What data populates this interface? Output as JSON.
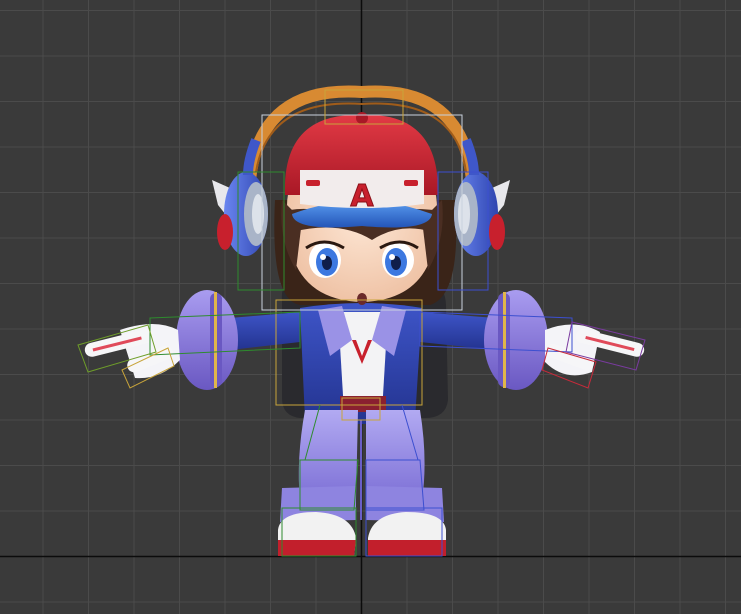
{
  "viewport": {
    "background": "#3a3a3a",
    "grid_color": "#4b4b4b",
    "axis_color": "#0c0c0c"
  },
  "scene": {
    "character": "chibi-boy-rig",
    "colors": {
      "cap_red": "#c8202d",
      "visor_blue": "#2f6fd0",
      "headphone_band": "#d88a32",
      "headphone_blue": "#3f57c9",
      "jacket_blue": "#2d3fa8",
      "sleeve_lavender": "#8a78d8",
      "pants_lavender": "#9a92e6",
      "shirt_white": "#f3f3f5",
      "skin": "#f6d7c0",
      "hair_brown": "#4a2e22",
      "eye_blue": "#3c78e0",
      "shoe_white": "#f2f2f2",
      "shoe_red": "#c21f2c"
    },
    "cap_letter": "A",
    "shirt_letter": "V",
    "rig_box_colors": [
      "#c9d2dd",
      "#2e8b2e",
      "#3c4fd0",
      "#c8a43a",
      "#6f9e2a",
      "#7a3aa0",
      "#c82a3a"
    ]
  }
}
